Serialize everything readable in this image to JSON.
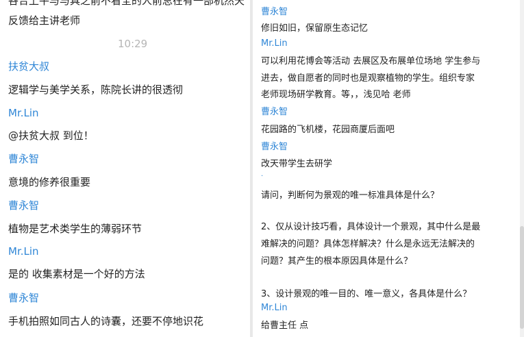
{
  "left_chat": {
    "cut_text": "各合上平与与具之前不看全的人前总在有一部机然天",
    "messages": [
      {
        "text": "反馈给主讲老师"
      },
      {
        "time": "10:29"
      },
      {
        "sender": "扶贫大叔"
      },
      {
        "text": "逻辑学与美学关系，陈院长讲的很透彻"
      },
      {
        "sender": "Mr.Lin"
      },
      {
        "text": "@扶贫大叔 到位！"
      },
      {
        "sender": "曹永智"
      },
      {
        "text": "意境的修养很重要"
      },
      {
        "sender": "曹永智"
      },
      {
        "text": "植物是艺术类学生的薄弱环节"
      },
      {
        "sender": "Mr.Lin"
      },
      {
        "text": "是的 收集素材是一个好的方法"
      },
      {
        "sender": "曹永智"
      },
      {
        "text": "手机拍照如同古人的诗囊，还要不停地识花"
      }
    ]
  },
  "right_chat": {
    "lines": [
      {
        "sender": "曹永智"
      },
      {
        "text": "修旧如旧，保留原生态记忆"
      },
      {
        "sender": "Mr.Lin"
      },
      {
        "text": "可以利用花博会等活动 去展区及布展单位场地 学生参与"
      },
      {
        "text": "进去，做自愿者的同时也是观察植物的学生。组织专家"
      },
      {
        "text": "老师现场研学教育。等，，浅见哈 老师"
      },
      {
        "sender": "曹永智"
      },
      {
        "text": "花园路的飞机楼，花园商厦后面吧"
      },
      {
        "sender": "曹永智"
      },
      {
        "text": "改天带学生去研学"
      },
      {
        "text": "."
      },
      {
        "text": "请问，判断何为景观的唯一标准具体是什么？"
      },
      {
        "text": "2、仅从设计技巧看，具体设计一个景观，其中什么是最"
      },
      {
        "text": "难解决的问题？具体怎样解决？什么是永远无法解决的"
      },
      {
        "text": "问题？其产生的根本原因具体是什么？"
      },
      {
        "text": "3、设计景观的唯一目的、唯一意义，各具体是什么？"
      },
      {
        "sender": "Mr.Lin"
      },
      {
        "text": "给曹主任 点"
      }
    ]
  },
  "colors": {
    "sender": "#2f86d6",
    "text": "#222222",
    "time": "#b5b5b5"
  }
}
